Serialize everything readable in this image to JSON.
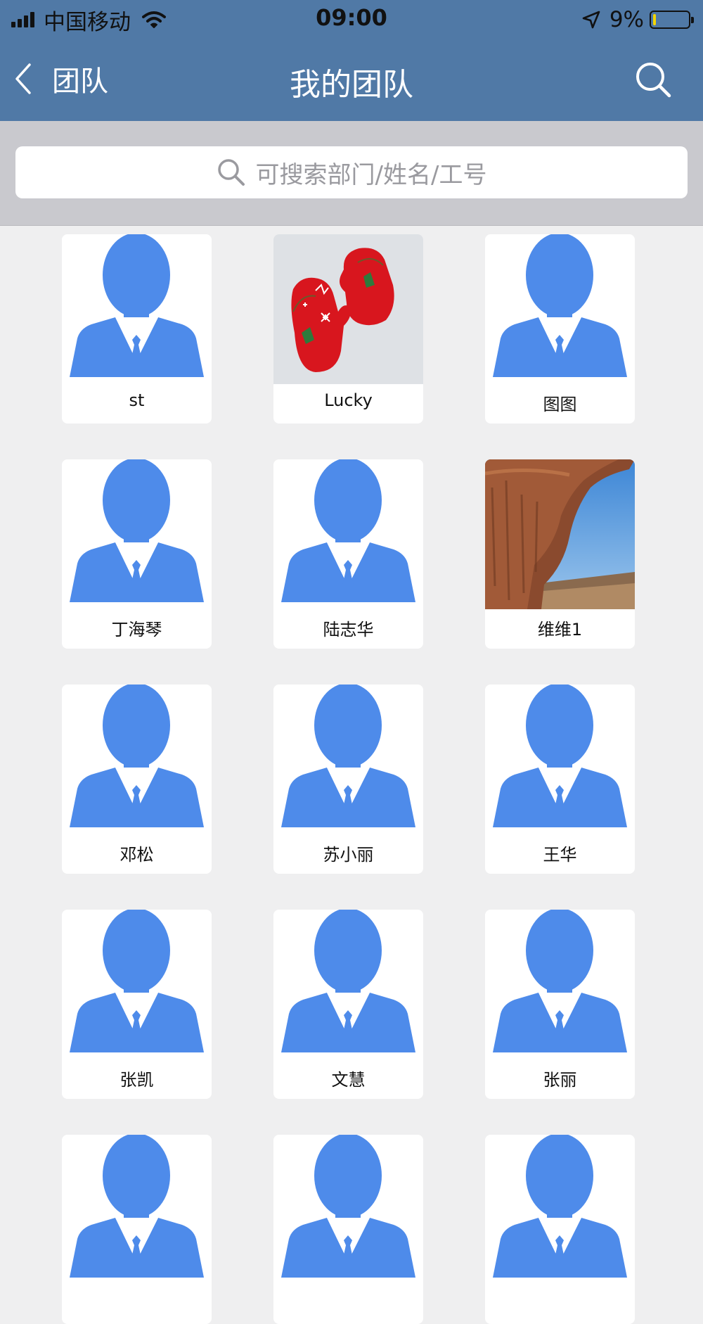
{
  "status_bar": {
    "carrier": "中国移动",
    "time": "09:00",
    "battery": "9%",
    "battery_level": 0.09,
    "icons": [
      "signal-icon",
      "wifi-icon",
      "location-arrow-icon",
      "battery-icon"
    ]
  },
  "nav": {
    "back_label": "团队",
    "title": "我的团队",
    "back_icon": "chevron-left-icon",
    "search_icon": "search-icon"
  },
  "search": {
    "placeholder": "可搜索部门/姓名/工号"
  },
  "colors": {
    "header": "#5079a6",
    "search_section": "#c9c9ce",
    "background": "#efeff0",
    "avatar_blue": "#4e8bea",
    "card": "#ffffff"
  },
  "members": [
    {
      "name": "st",
      "photo": "default-avatar"
    },
    {
      "name": "Lucky",
      "photo": "red-mittens-photo"
    },
    {
      "name": "图图",
      "photo": "default-avatar"
    },
    {
      "name": "丁海琴",
      "photo": "default-avatar"
    },
    {
      "name": "陆志华",
      "photo": "default-avatar"
    },
    {
      "name": "维维1",
      "photo": "canyon-rock-photo"
    },
    {
      "name": "邓松",
      "photo": "default-avatar"
    },
    {
      "name": "苏小丽",
      "photo": "default-avatar"
    },
    {
      "name": "王华",
      "photo": "default-avatar"
    },
    {
      "name": "张凯",
      "photo": "default-avatar"
    },
    {
      "name": "文慧",
      "photo": "default-avatar"
    },
    {
      "name": "张丽",
      "photo": "default-avatar"
    },
    {
      "name": "",
      "photo": "default-avatar"
    },
    {
      "name": "",
      "photo": "default-avatar"
    },
    {
      "name": "",
      "photo": "default-avatar"
    }
  ]
}
